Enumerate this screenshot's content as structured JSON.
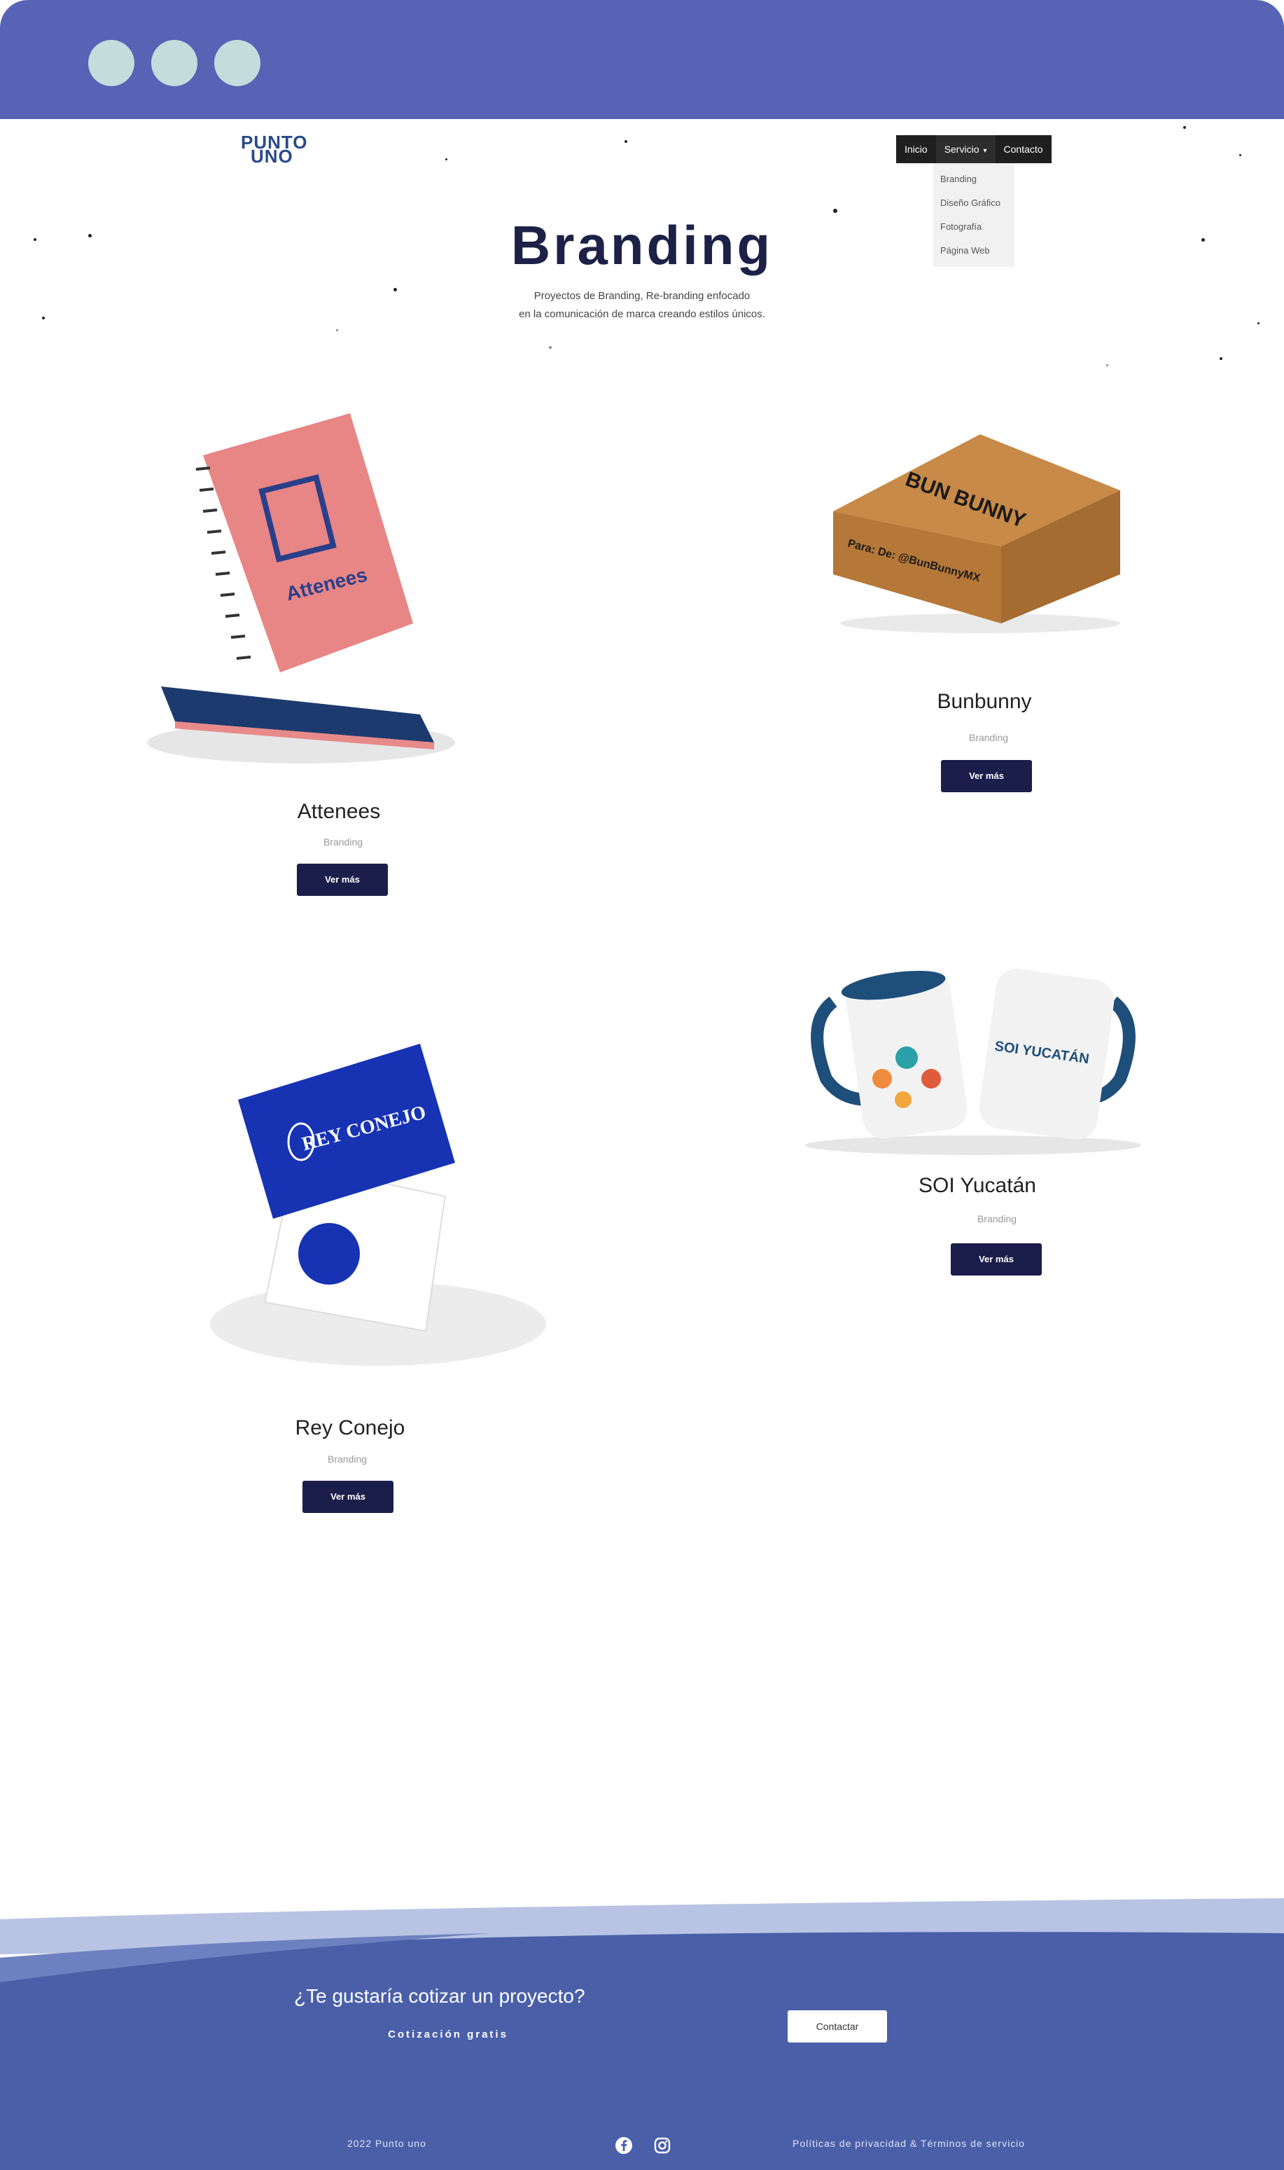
{
  "header": {
    "logo_line1": "PUNTO",
    "logo_line2": "UNO",
    "nav": [
      {
        "label": "Inicio"
      },
      {
        "label": "Servicio"
      },
      {
        "label": "Contacto"
      }
    ],
    "dropdown": [
      "Branding",
      "Diseño Gráfico",
      "Fotografía",
      "Página Web"
    ]
  },
  "hero": {
    "title": "Branding",
    "subtitle_line1": "Proyectos de Branding, Re-branding enfocado",
    "subtitle_line2": "en la comunicación de marca creando estilos únicos."
  },
  "projects": [
    {
      "title": "Attenees",
      "category": "Branding",
      "button": "Ver más"
    },
    {
      "title": "Bunbunny",
      "category": "Branding",
      "button": "Ver más"
    },
    {
      "title": "SOI Yucatán",
      "category": "Branding",
      "button": "Ver más"
    },
    {
      "title": "Rey Conejo",
      "category": "Branding",
      "button": "Ver más"
    }
  ],
  "artwork": {
    "attenees_brand": "Attenees",
    "box_brand": "BUN BUNNY",
    "box_text": "Para: De: @BunBunnyMX",
    "soi_brand": "SOI YUCATÁN",
    "rey_brand": "REY CONEJO"
  },
  "cta": {
    "title": "¿Te gustaría cotizar un proyecto?",
    "subtitle": "Cotización gratis",
    "button": "Contactar"
  },
  "footer": {
    "copyright": "2022 Punto uno",
    "legal": "Políticas de privacidad & Términos de servicio",
    "icons": [
      "facebook-icon",
      "instagram-icon"
    ]
  },
  "colors": {
    "chrome": "#5763b5",
    "chrome_dots": "#c4dcdb",
    "footer": "#4a5fa8",
    "button": "#1b1d4a",
    "title": "#1d2147"
  }
}
